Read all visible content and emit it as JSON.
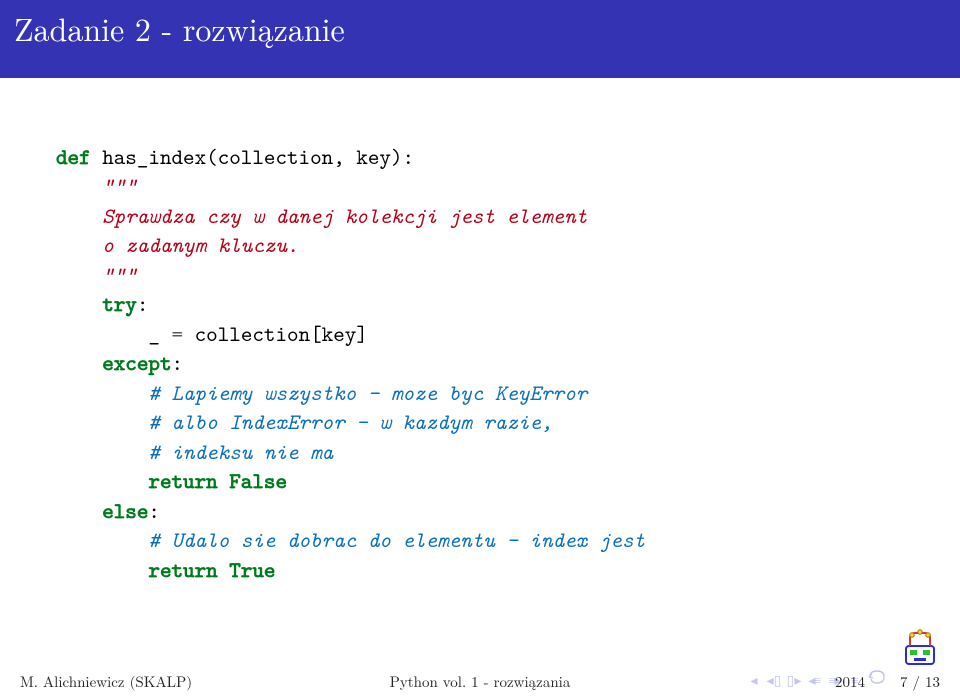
{
  "title": "Zadanie 2 - rozwiązanie",
  "code": {
    "l1_kw_def": "def",
    "l1_sig": " has_index(collection, key",
    "l1_close": "):",
    "l2_doc_open": "    \"\"\"",
    "l3_doc": "    Sprawdza czy w danej kolekcji jest element",
    "l4_doc": "    o zadanym kluczu.",
    "l5_doc_close": "    \"\"\"",
    "l6_try": "    try",
    "l6_colon": ":",
    "l7_assign": "        _ ",
    "l7_eq": "=",
    "l7_rest": " collection[key]",
    "l8_except": "    except",
    "l8_colon": ":",
    "l9_cmt": "        # Lapiemy wszystko - moze byc KeyError",
    "l10_cmt": "        # albo IndexError - w kazdym razie,",
    "l11_cmt": "        # indeksu nie ma",
    "l12_ret": "        return",
    "l12_bool": " False",
    "l13_else": "    else",
    "l13_colon": ":",
    "l14_cmt": "        # Udalo sie dobrac do elementu - index jest",
    "l15_ret": "        return",
    "l15_bool": " True"
  },
  "footer": {
    "left": "M. Alichniewicz (SKALP)",
    "center": "Python vol. 1 - rozwiązania",
    "year": "2014",
    "page": "7 / 13"
  }
}
